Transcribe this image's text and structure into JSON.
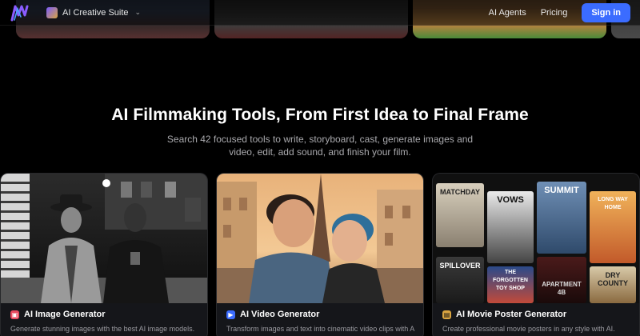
{
  "nav": {
    "suite_label": "AI Creative Suite",
    "links": [
      "AI Agents",
      "Pricing"
    ],
    "signin_label": "Sign in"
  },
  "hero": {
    "title": "AI Filmmaking Tools, From First Idea to Final Frame",
    "subtitle": "Search 42 focused tools to write, storyboard, cast, generate images and video, edit, add sound, and finish your film."
  },
  "cards": [
    {
      "title": "AI Image Generator",
      "desc": "Generate stunning images with the best AI image models."
    },
    {
      "title": "AI Video Generator",
      "desc": "Transform images and text into cinematic video clips with AI."
    },
    {
      "title": "AI Movie Poster Generator",
      "desc": "Create professional movie posters in any style with AI."
    }
  ],
  "posters": [
    "MATCHDAY",
    "VOWS",
    "SUMMIT",
    "LONG WAY HOME",
    "SPILLOVER",
    "THE FORGOTTEN TOY SHOP",
    "APARTMENT 4B",
    "DRY COUNTY"
  ],
  "colors": {
    "accent": "#3b6cff",
    "background": "#000000"
  }
}
